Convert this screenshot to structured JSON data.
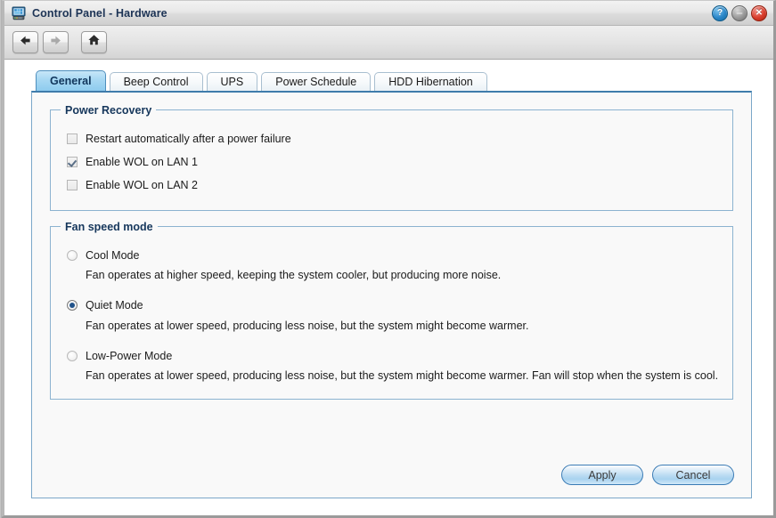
{
  "window": {
    "title": "Control Panel - Hardware",
    "title_icon": "control-panel-icon",
    "buttons": {
      "help": "?",
      "minimize": "",
      "close": "✕"
    }
  },
  "toolbar": {
    "back": "back-arrow-icon",
    "forward": "forward-arrow-icon",
    "home": "home-icon"
  },
  "tabs": [
    {
      "label": "General",
      "active": true
    },
    {
      "label": "Beep Control",
      "active": false
    },
    {
      "label": "UPS",
      "active": false
    },
    {
      "label": "Power Schedule",
      "active": false
    },
    {
      "label": "HDD Hibernation",
      "active": false
    }
  ],
  "power_recovery": {
    "legend": "Power Recovery",
    "options": [
      {
        "label": "Restart automatically after a power failure",
        "checked": false
      },
      {
        "label": "Enable WOL on LAN 1",
        "checked": true
      },
      {
        "label": "Enable WOL on LAN 2",
        "checked": false
      }
    ]
  },
  "fan_speed_mode": {
    "legend": "Fan speed mode",
    "options": [
      {
        "label": "Cool Mode",
        "selected": false,
        "description": "Fan operates at higher speed, keeping the system cooler, but producing more noise."
      },
      {
        "label": "Quiet Mode",
        "selected": true,
        "description": "Fan operates at lower speed, producing less noise, but the system might become warmer."
      },
      {
        "label": "Low-Power Mode",
        "selected": false,
        "description": "Fan operates at lower speed, producing less noise, but the system might become warmer. Fan will stop when the system is cool."
      }
    ]
  },
  "actions": {
    "apply": "Apply",
    "cancel": "Cancel"
  },
  "colors": {
    "accent_blue": "#3f7cab",
    "tab_active": "#8ecbee",
    "fieldset_border": "#8cb3d0",
    "legend_text": "#16375c",
    "title_text": "#1c3355",
    "radio_dot": "#20528a",
    "close_red": "#d93d2c",
    "help_blue": "#2a86c8"
  }
}
